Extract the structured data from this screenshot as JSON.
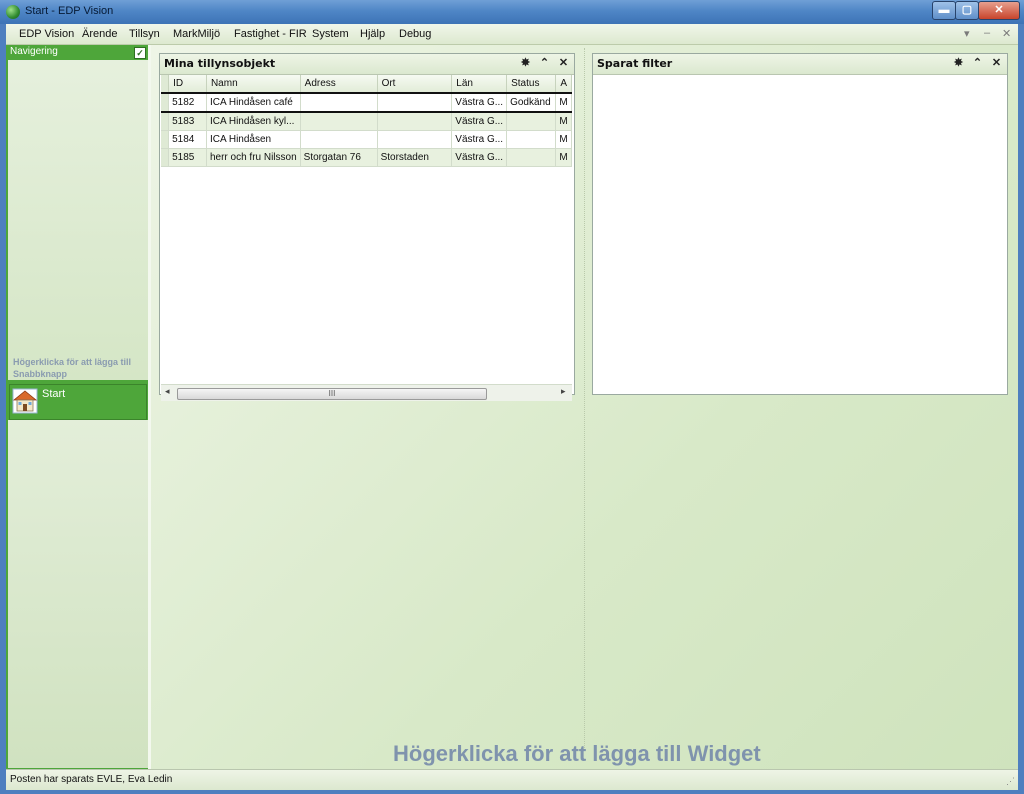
{
  "window": {
    "title": "Start - EDP Vision",
    "controls": {
      "minimize": "▬",
      "maximize": "▢",
      "close": "✕"
    }
  },
  "menubar": {
    "items": [
      "EDP Vision",
      "Ärende",
      "Tillsyn",
      "MarkMiljö",
      "Fastighet - FIR",
      "System",
      "Hjälp",
      "Debug"
    ],
    "mdi_controls": {
      "dropdown": "▾",
      "minimize": "–",
      "close": "✕"
    }
  },
  "navigation": {
    "title": "Navigering",
    "checked": true,
    "hint": "Högerklicka för att lägga till Snabbknapp",
    "shortcuts": [
      {
        "label": "Start",
        "icon": "house-icon"
      }
    ]
  },
  "widgets": {
    "tillsyn": {
      "title": "Mina tillynsobjekt",
      "columns": [
        "ID",
        "Namn",
        "Adress",
        "Ort",
        "Län",
        "Status",
        "A"
      ],
      "rows": [
        [
          "5182",
          "ICA Hindåsen café",
          "",
          "",
          "Västra G...",
          "Godkänd",
          "M"
        ],
        [
          "5183",
          "ICA Hindåsen kyl...",
          "",
          "",
          "Västra G...",
          "",
          "M"
        ],
        [
          "5184",
          "ICA Hindåsen",
          "",
          "",
          "Västra G...",
          "",
          "M"
        ],
        [
          "5185",
          "herr och fru Nilsson",
          "Storgatan 76",
          "Storstaden",
          "Västra G...",
          "",
          "M"
        ]
      ],
      "selected_row": 0,
      "scrollbar": {
        "left_arrow": "◂",
        "right_arrow": "▸",
        "grip": "III"
      }
    },
    "sparat_filter": {
      "title": "Sparat filter"
    },
    "widget_icons": {
      "settings": "✸",
      "collapse": "⌃",
      "close": "✕"
    }
  },
  "workspace": {
    "hint": "Högerklicka för att lägga till Widget"
  },
  "statusbar": {
    "text": "Posten har sparats  EVLE, Eva Ledin",
    "grip": "⋰"
  },
  "colors": {
    "nav_green": "#4ea63a",
    "title_blue": "#4f86c6",
    "hint_gray_blue": "#7f93ad"
  }
}
